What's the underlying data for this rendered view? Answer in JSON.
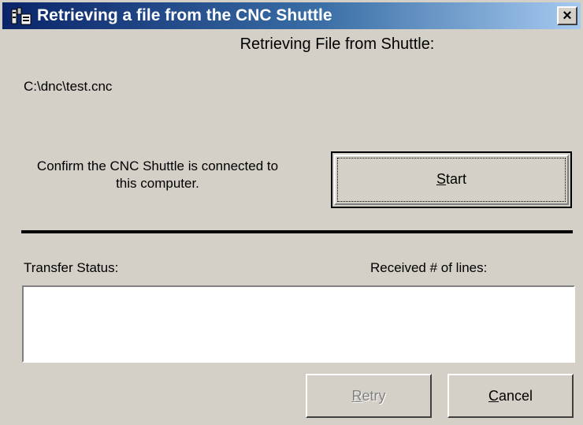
{
  "window": {
    "title": "Retrieving a file from the CNC Shuttle",
    "close_glyph": "×"
  },
  "heading": "Retrieving File from Shuttle:",
  "file_path": "C:\\dnc\\test.cnc",
  "confirm_text_line1": "Confirm the CNC Shuttle is connected to",
  "confirm_text_line2": "this computer.",
  "buttons": {
    "start": {
      "mnemonic": "S",
      "rest": "tart"
    },
    "retry": {
      "mnemonic": "R",
      "rest": "etry",
      "enabled": false
    },
    "cancel": {
      "mnemonic": "C",
      "rest": "ancel"
    }
  },
  "transfer_status_label": "Transfer Status:",
  "received_lines_label": "Received # of lines:",
  "transfer_status_value": ""
}
